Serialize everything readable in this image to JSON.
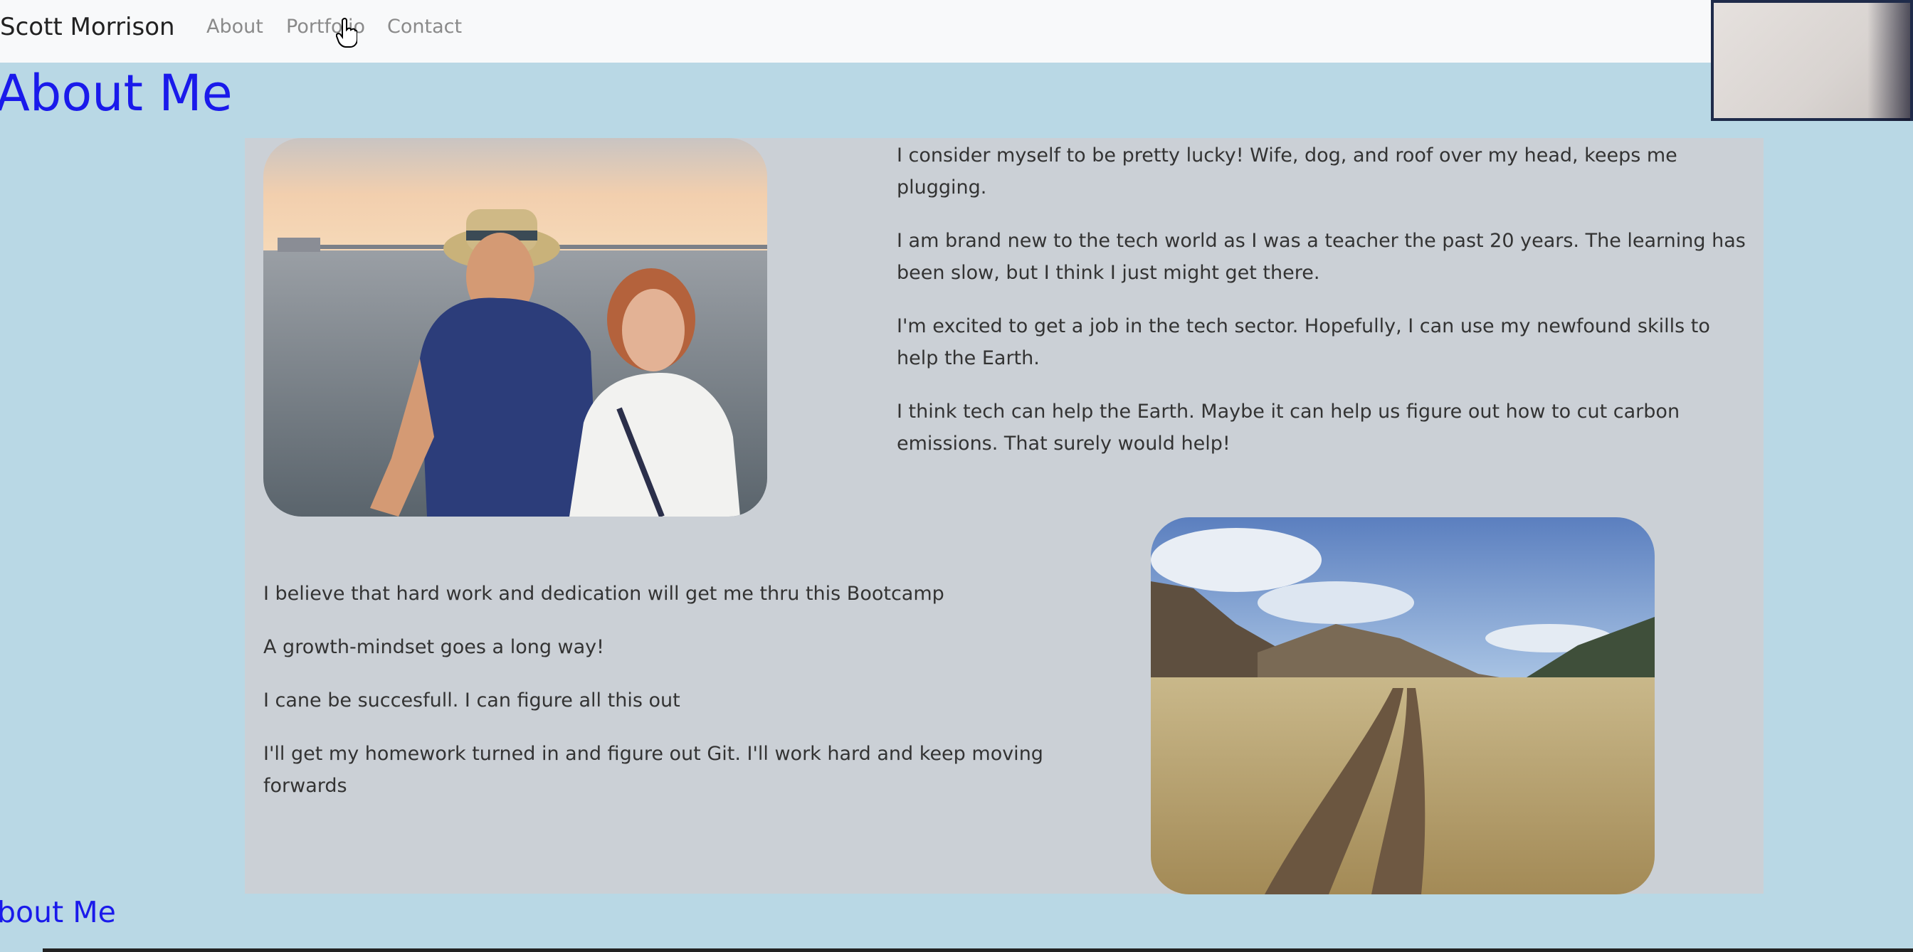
{
  "navbar": {
    "brand": "Scott Morrison",
    "links": [
      "About",
      "Portfolio",
      "Contact"
    ]
  },
  "main": {
    "title": "About Me",
    "top_paragraphs": [
      "I consider myself to be pretty lucky! Wife, dog, and roof over my head, keeps me plugging.",
      "I am brand new to the tech world as I was a teacher the past 20 years. The learning has been slow, but I think I just might get there.",
      "I'm excited to get a job in the tech sector. Hopefully, I can use my newfound skills to help the Earth.",
      "I think tech can help the Earth. Maybe it can help us figure out how to cut carbon emissions. That surely would help!"
    ],
    "bottom_paragraphs": [
      "I believe that hard work and dedication will get me thru this Bootcamp",
      "A growth-mindset goes a long way!",
      "I cane be succesfull. I can figure all this out",
      "I'll get my homework turned in and figure out Git. I'll work hard and keep moving forwards"
    ]
  },
  "footer": {
    "title": "bout Me"
  },
  "colors": {
    "page_background": "#b9d8e5",
    "card_background": "#cbd0d6",
    "title_blue": "#1a1aeb",
    "navbar_background": "#f8f9fa"
  }
}
